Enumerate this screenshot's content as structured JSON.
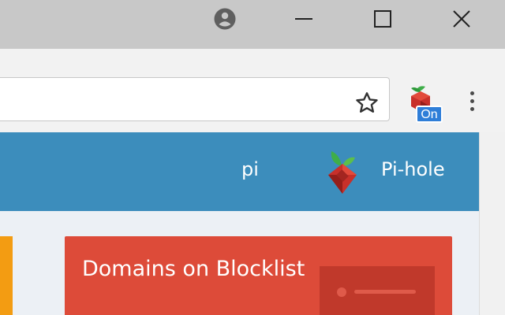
{
  "browser": {
    "window_controls": {
      "account": "account-circle-icon",
      "minimize": "minimize-icon",
      "maximize": "maximize-icon",
      "close": "close-icon"
    },
    "bookmark_icon": "star-outline-icon",
    "extension": {
      "icon": "pi-hole-extension-icon",
      "badge": "On",
      "badge_color": "#2f7ed8"
    },
    "menu_icon": "vertical-dots-icon"
  },
  "page": {
    "header": {
      "hostname": "pi",
      "brand": "Pi-hole",
      "bg_color": "#3c8dbc"
    },
    "cards": [
      {
        "title": "Domains on Blocklist",
        "color": "#dd4b39"
      }
    ],
    "left_card_color": "#f39c12"
  }
}
